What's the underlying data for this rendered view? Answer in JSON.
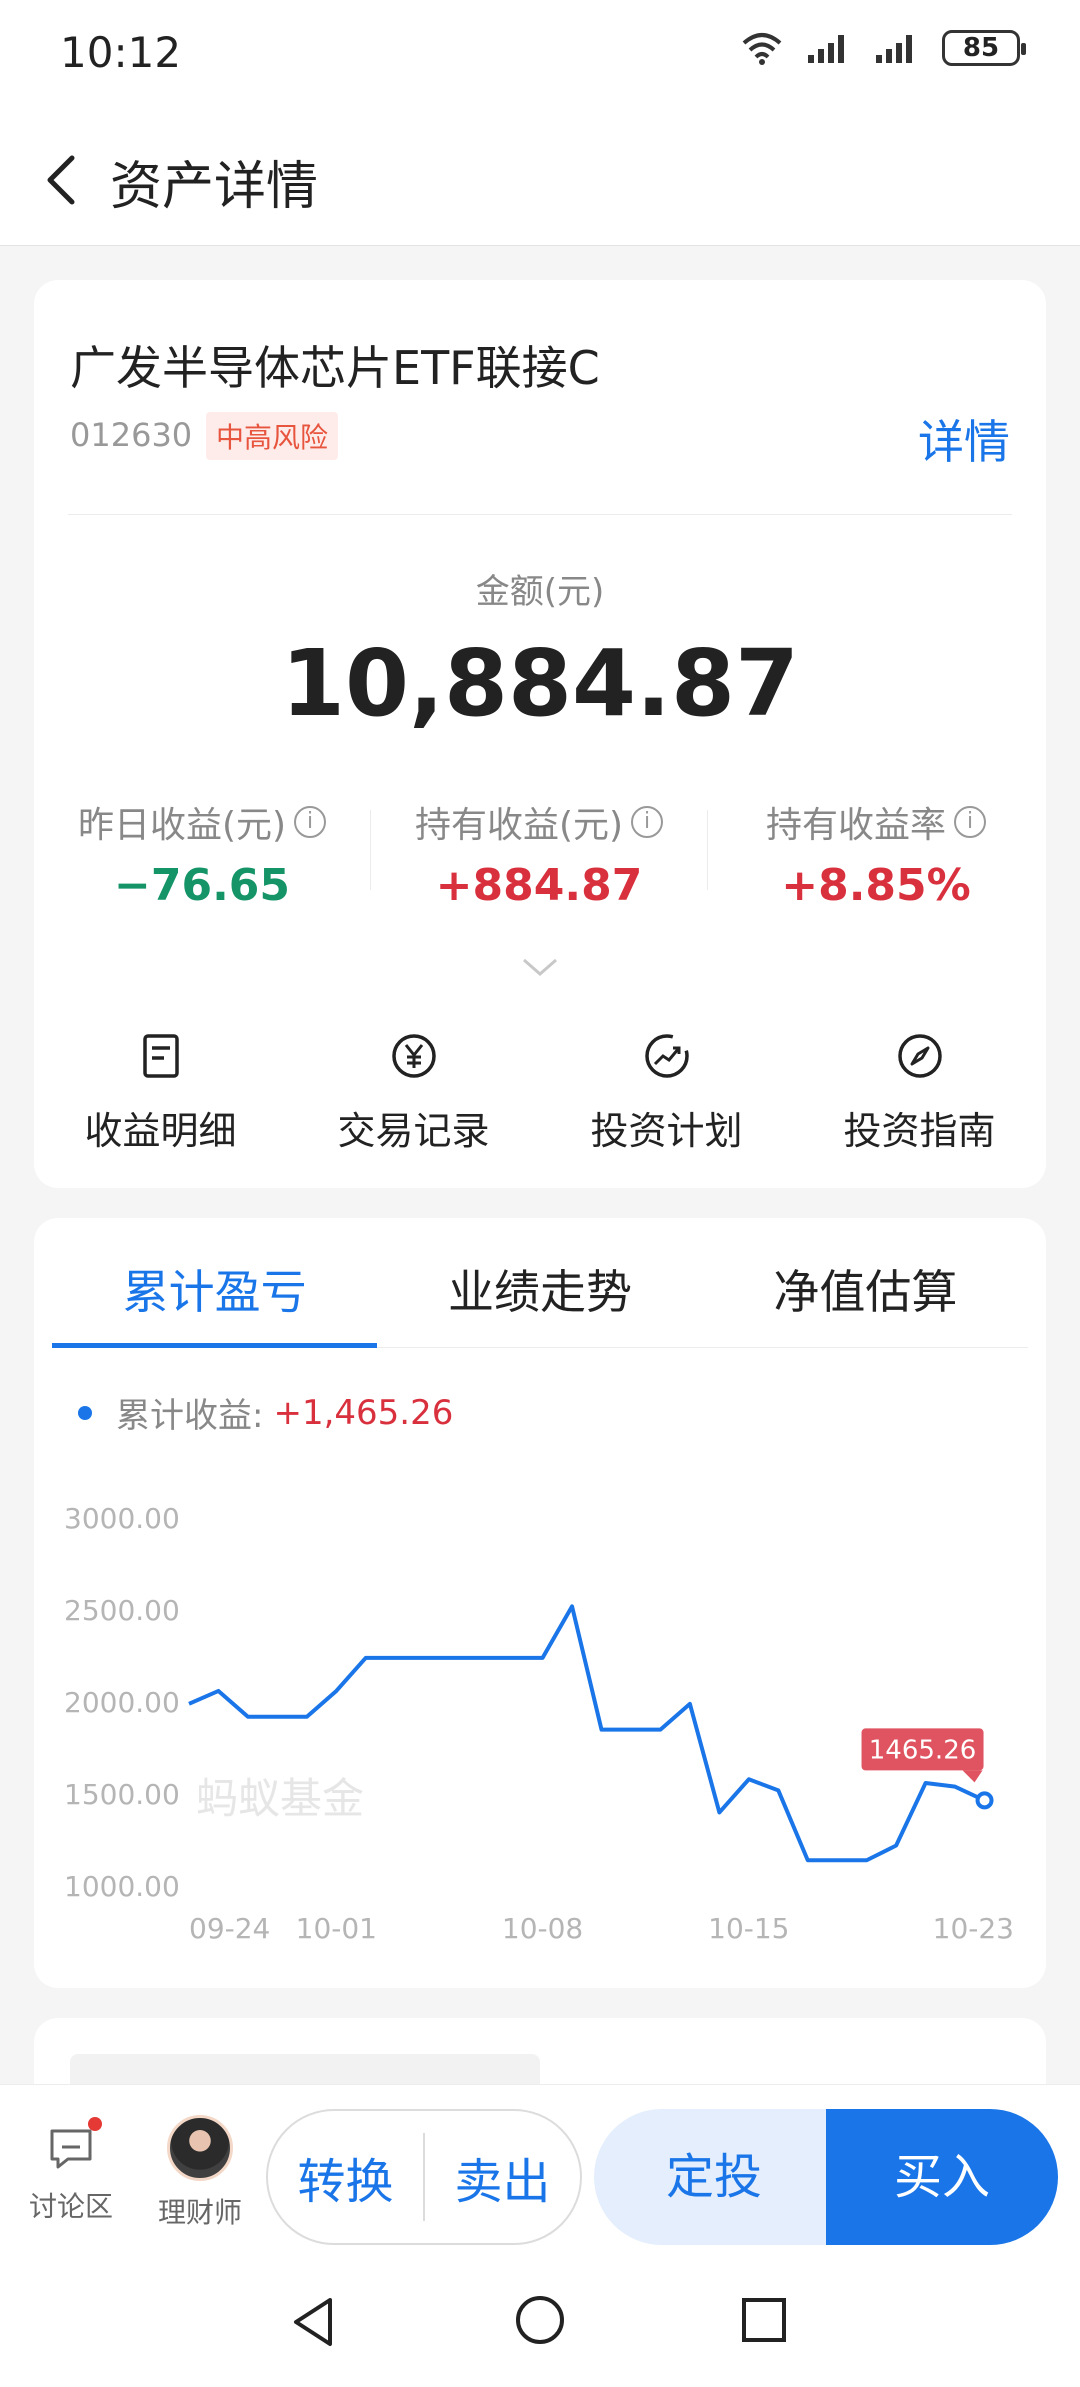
{
  "status_bar": {
    "time": "10:12",
    "battery": "85"
  },
  "nav": {
    "title": "资产详情"
  },
  "fund": {
    "name": "广发半导体芯片ETF联接C",
    "code": "012630",
    "risk": "中高风险",
    "detail_link": "详情",
    "amount_label": "金额(元)",
    "amount": "10,884.87"
  },
  "stats": [
    {
      "label": "昨日收益(元)",
      "value": "−76.65"
    },
    {
      "label": "持有收益(元)",
      "value": "+884.87"
    },
    {
      "label": "持有收益率",
      "value": "+8.85%"
    }
  ],
  "quick_actions": [
    {
      "label": "收益明细",
      "icon": "document-icon"
    },
    {
      "label": "交易记录",
      "icon": "yuan-icon"
    },
    {
      "label": "投资计划",
      "icon": "trend-icon"
    },
    {
      "label": "投资指南",
      "icon": "compass-icon"
    }
  ],
  "tabs": [
    {
      "label": "累计盈亏"
    },
    {
      "label": "业绩走势"
    },
    {
      "label": "净值估算"
    }
  ],
  "legend": {
    "label": "累计收益:",
    "value": "+1,465.26"
  },
  "chart_data": {
    "type": "line",
    "watermark": "蚂蚁基金",
    "x": [
      "09-24",
      "09-25",
      "09-26",
      "09-27",
      "09-30",
      "10-01",
      "10-02",
      "10-03",
      "10-04",
      "10-05",
      "10-06",
      "10-07",
      "10-08",
      "10-09",
      "10-10",
      "10-11",
      "10-12",
      "10-13",
      "10-14",
      "10-15",
      "10-16",
      "10-17",
      "10-18",
      "10-19",
      "10-20",
      "10-21",
      "10-22",
      "10-23",
      "10-24"
    ],
    "values": [
      1990,
      2060,
      1920,
      1920,
      1920,
      2060,
      2240,
      2240,
      2240,
      2240,
      2240,
      2240,
      2240,
      2520,
      1850,
      1850,
      1850,
      1990,
      1400,
      1580,
      1520,
      1140,
      1140,
      1140,
      1220,
      1560,
      1540,
      1465.26
    ],
    "x_ticks": [
      "09-24",
      "10-01",
      "10-08",
      "10-15",
      "10-23"
    ],
    "y_ticks": [
      "3000.00",
      "2500.00",
      "2000.00",
      "1500.00",
      "1000.00"
    ],
    "ylim": [
      1000,
      3000
    ],
    "last_label": "1465.26",
    "colors": {
      "line": "#1a76e8",
      "label_bg": "#e05360",
      "grid_text": "#b5b5b5"
    }
  },
  "bottom_bar": {
    "discussion": "讨论区",
    "advisor": "理财师",
    "convert": "转换",
    "sell": "卖出",
    "auto_invest": "定投",
    "buy": "买入"
  }
}
